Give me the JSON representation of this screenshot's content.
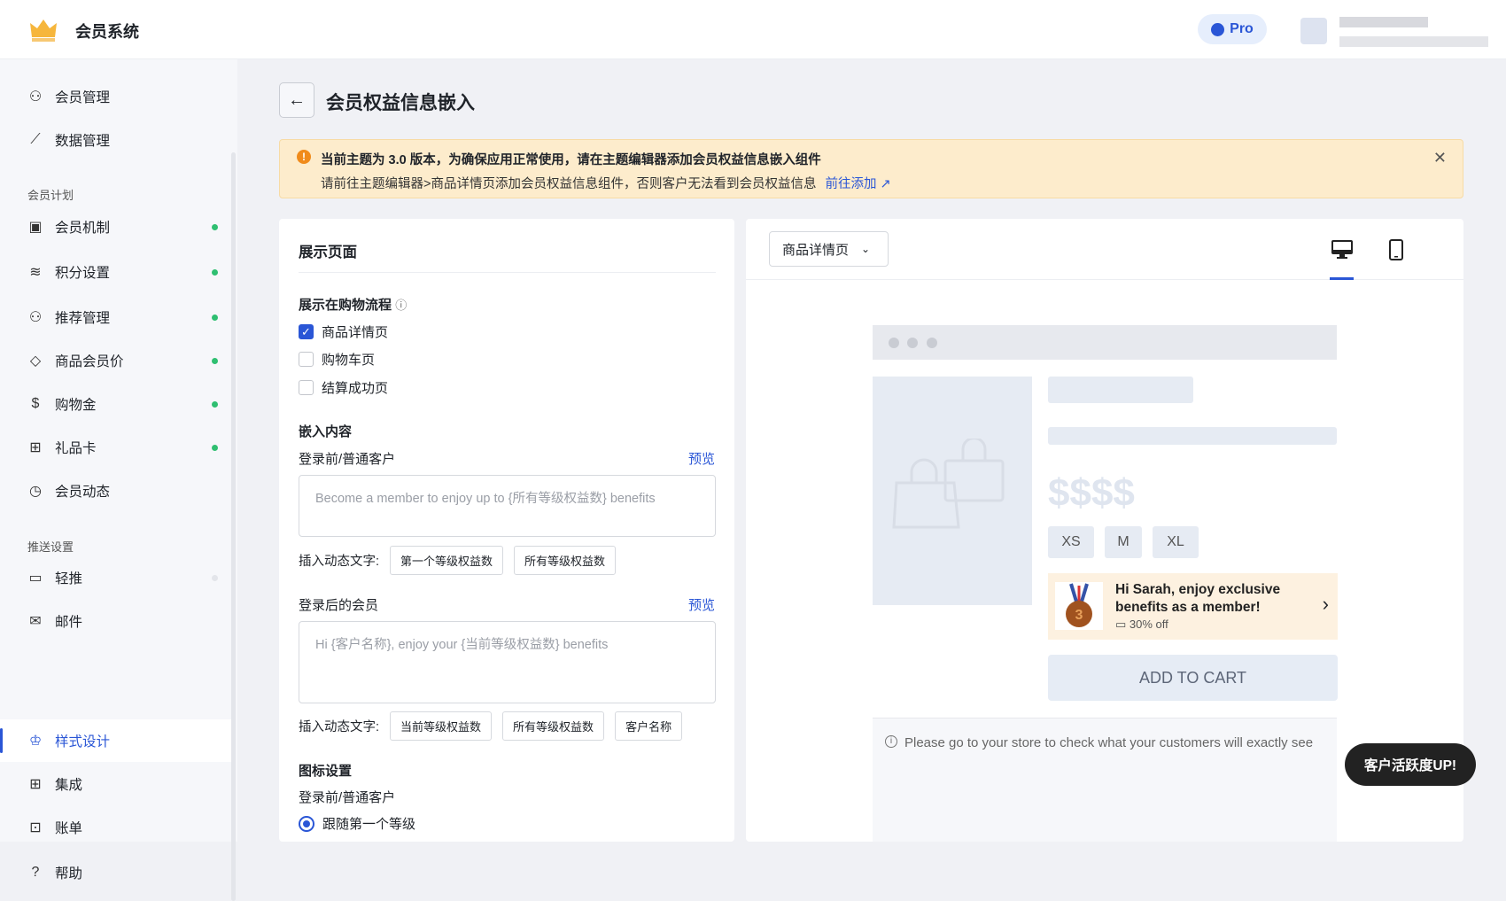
{
  "header": {
    "app_title": "会员系统",
    "pro_label": "Pro"
  },
  "sidebar": {
    "items": [
      {
        "label": "会员管理",
        "icon": "user-icon"
      },
      {
        "label": "数据管理",
        "icon": "chart-icon"
      },
      {
        "label": "会员机制",
        "icon": "id-icon"
      },
      {
        "label": "积分设置",
        "icon": "coins-icon"
      },
      {
        "label": "推荐管理",
        "icon": "user-plus-icon"
      },
      {
        "label": "商品会员价",
        "icon": "tag-icon"
      },
      {
        "label": "购物金",
        "icon": "wallet-icon"
      },
      {
        "label": "礼品卡",
        "icon": "gift-card-icon"
      },
      {
        "label": "会员动态",
        "icon": "clock-icon"
      },
      {
        "label": "轻推",
        "icon": "popup-icon"
      },
      {
        "label": "邮件",
        "icon": "mail-icon"
      },
      {
        "label": "样式设计",
        "icon": "crown-icon"
      },
      {
        "label": "集成",
        "icon": "grid-icon"
      },
      {
        "label": "账单",
        "icon": "bill-icon"
      },
      {
        "label": "帮助",
        "icon": "help-icon"
      }
    ],
    "groups": [
      "会员计划",
      "推送设置"
    ]
  },
  "page": {
    "title": "会员权益信息嵌入"
  },
  "banner": {
    "line1": "当前主题为 3.0 版本，为确保应用正常使用，请在主题编辑器添加会员权益信息嵌入组件",
    "line2": "请前往主题编辑器>商品详情页添加会员权益信息组件，否则客户无法看到会员权益信息",
    "link": "前往添加"
  },
  "settings": {
    "title": "展示页面",
    "flow_label": "展示在购物流程",
    "checkboxes": [
      {
        "label": "商品详情页",
        "checked": true
      },
      {
        "label": "购物车页",
        "checked": false
      },
      {
        "label": "结算成功页",
        "checked": false
      }
    ],
    "embed_title": "嵌入内容",
    "guest_label": "登录前/普通客户",
    "preview": "预览",
    "guest_placeholder": "Become a member to enjoy up to {所有等级权益数} benefits",
    "insert_label": "插入动态文字:",
    "guest_tags": [
      "第一个等级权益数",
      "所有等级权益数"
    ],
    "member_label": "登录后的会员",
    "member_placeholder": "Hi {客户名称}, enjoy your {当前等级权益数} benefits",
    "member_tags": [
      "当前等级权益数",
      "所有等级权益数",
      "客户名称"
    ],
    "icon_title": "图标设置",
    "icon_guest_label": "登录前/普通客户",
    "icon_radio": "跟随第一个等级"
  },
  "preview_panel": {
    "page_select": "商品详情页",
    "price": "$$$$",
    "sizes": [
      "XS",
      "M",
      "XL"
    ],
    "benefit_title": "Hi Sarah, enjoy exclusive benefits as a member!",
    "benefit_sub": "30% off",
    "add_to_cart": "ADD TO CART",
    "note": "Please go to your store to check what your customers will exactly see"
  },
  "feedback_button": "客户活跃度UP!"
}
